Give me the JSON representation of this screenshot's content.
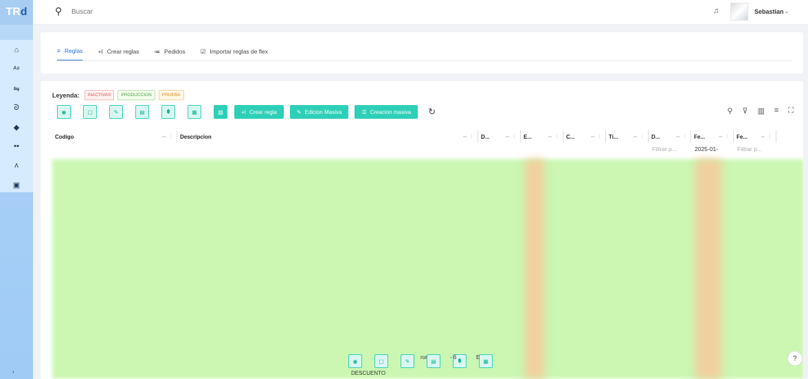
{
  "app": {
    "logo_a": "TR",
    "logo_b": "d"
  },
  "topbar": {
    "search_placeholder": "Buscar",
    "user_name": "Sebastian"
  },
  "sidebar": {
    "icons": [
      "home-icon",
      "users-group-icon",
      "transfer-icon",
      "support-icon",
      "tag-icon",
      "grid-icon",
      "user-icon",
      "database-icon"
    ]
  },
  "tabs": [
    {
      "label": "Reglas",
      "icon": "≡"
    },
    {
      "label": "Crear reglas",
      "icon": "+I"
    },
    {
      "label": "Pedidos",
      "icon": "≔"
    },
    {
      "label": "Importar reglas de flex",
      "icon": "☑"
    }
  ],
  "legend": {
    "label": "Leyenda:",
    "tags": [
      "INACTIVAS",
      "PRODUCCION",
      "PRUEBA"
    ]
  },
  "toolbar": {
    "crear": "Crear regla",
    "edicion": "Edicion Masiva",
    "creacion": "Creacion masiva"
  },
  "columns": [
    "Codigo",
    "Descripcion",
    "D...",
    "E...",
    "C...",
    "Ti...",
    "D...",
    "Fe...",
    "Fe..."
  ],
  "filters": {
    "d": "Filtrar p...",
    "fe1": "2025-01-",
    "fe2": "Filtrar p..."
  },
  "footer": {
    "desc": "DESCUENTO",
    "frag_a": "ror",
    "frag_b": "- 6",
    "frag_c": "E"
  }
}
